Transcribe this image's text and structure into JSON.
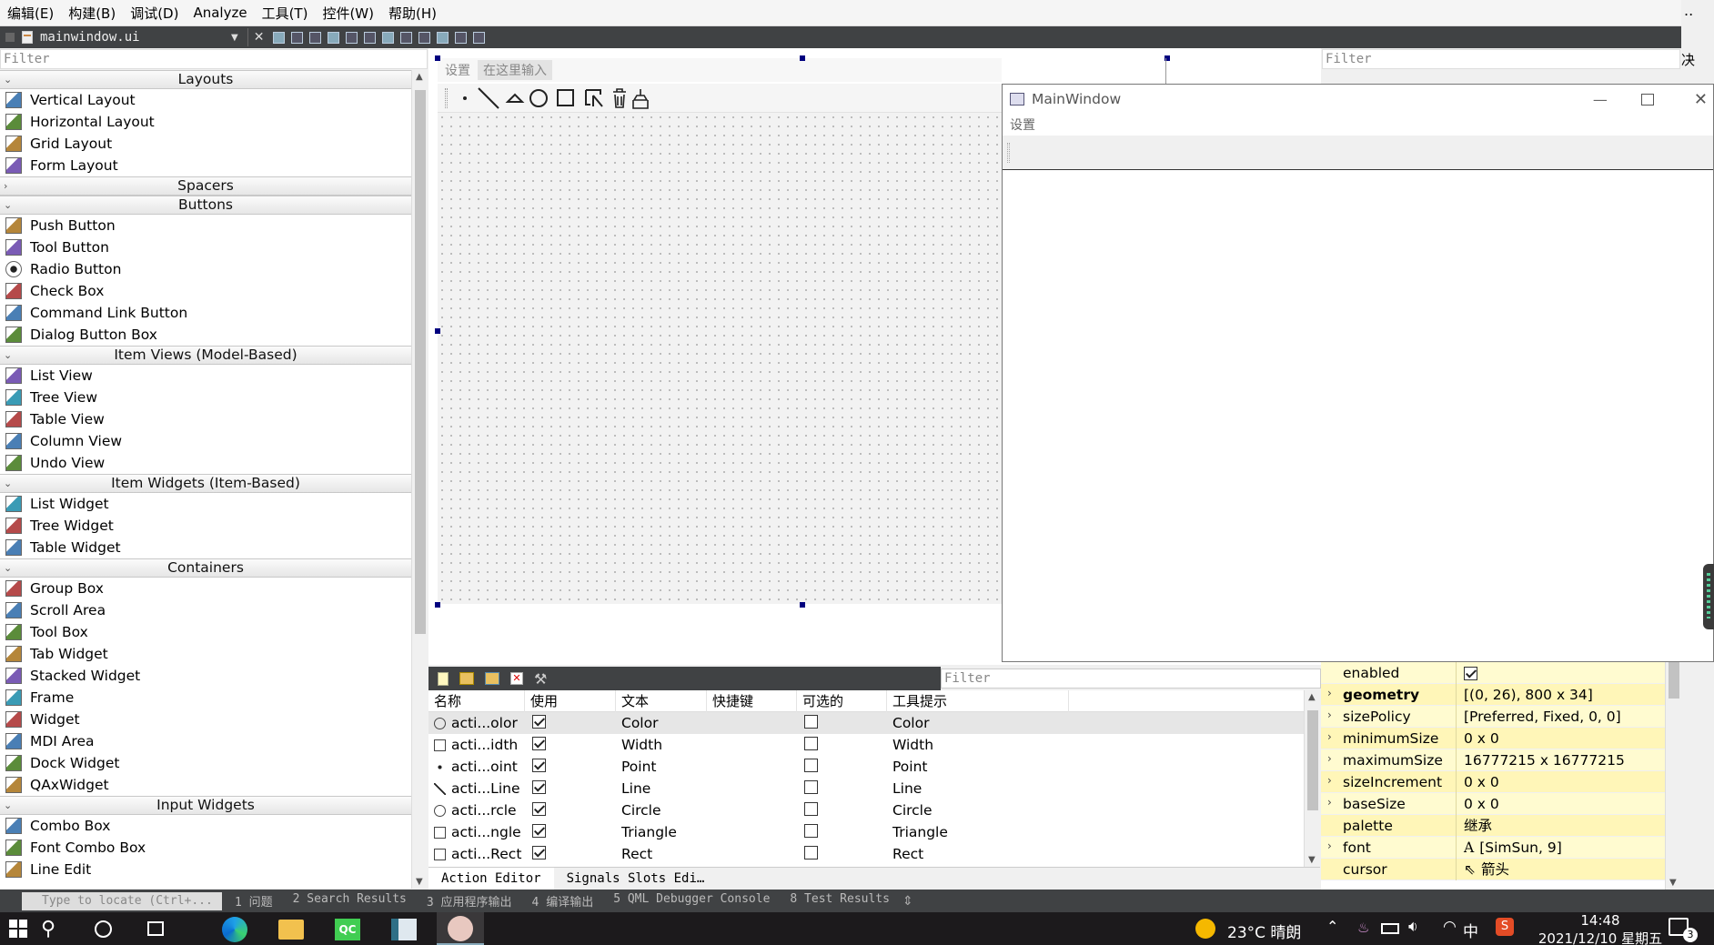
{
  "menu": [
    "编辑(E)",
    "构建(B)",
    "调试(D)",
    "Analyze",
    "工具(T)",
    "控件(W)",
    "帮助(H)"
  ],
  "editor_tab": {
    "file": "mainwindow.ui"
  },
  "widget_filter": "Filter",
  "right_filter": "Filter",
  "right_edge_text": "决",
  "top_right_text": "..",
  "widget_box": [
    {
      "category": "Layouts",
      "collapsed": false,
      "items": [
        "Vertical Layout",
        "Horizontal Layout",
        "Grid Layout",
        "Form Layout"
      ]
    },
    {
      "category": "Spacers",
      "collapsed": true,
      "items": []
    },
    {
      "category": "Buttons",
      "collapsed": false,
      "items": [
        "Push Button",
        "Tool Button",
        "Radio Button",
        "Check Box",
        "Command Link Button",
        "Dialog Button Box"
      ]
    },
    {
      "category": "Item Views (Model-Based)",
      "collapsed": false,
      "items": [
        "List View",
        "Tree View",
        "Table View",
        "Column View",
        "Undo View"
      ]
    },
    {
      "category": "Item Widgets (Item-Based)",
      "collapsed": false,
      "items": [
        "List Widget",
        "Tree Widget",
        "Table Widget"
      ]
    },
    {
      "category": "Containers",
      "collapsed": false,
      "items": [
        "Group Box",
        "Scroll Area",
        "Tool Box",
        "Tab Widget",
        "Stacked Widget",
        "Frame",
        "Widget",
        "MDI Area",
        "Dock Widget",
        "QAxWidget"
      ]
    },
    {
      "category": "Input Widgets",
      "collapsed": false,
      "items": [
        "Combo Box",
        "Font Combo Box",
        "Line Edit"
      ]
    }
  ],
  "form_menu": {
    "item": "设置",
    "placeholder": "在这里输入"
  },
  "main_window": {
    "title": "MainWindow",
    "menu_item": "设置"
  },
  "action_filter": "Filter",
  "action_editor": {
    "columns": [
      "名称",
      "使用",
      "文本",
      "快捷键",
      "可选的",
      "工具提示"
    ],
    "rows": [
      {
        "name": "acti...olor",
        "used": true,
        "text": "Color",
        "shortcut": "",
        "checkable": false,
        "tooltip": "Color",
        "icon": "palette-icon"
      },
      {
        "name": "acti...idth",
        "used": true,
        "text": "Width",
        "shortcut": "",
        "checkable": false,
        "tooltip": "Width",
        "icon": "width-icon"
      },
      {
        "name": "acti...oint",
        "used": true,
        "text": "Point",
        "shortcut": "",
        "checkable": false,
        "tooltip": "Point",
        "icon": "point-icon"
      },
      {
        "name": "acti...Line",
        "used": true,
        "text": "Line",
        "shortcut": "",
        "checkable": false,
        "tooltip": "Line",
        "icon": "line-icon"
      },
      {
        "name": "acti...rcle",
        "used": true,
        "text": "Circle",
        "shortcut": "",
        "checkable": false,
        "tooltip": "Circle",
        "icon": "circle-icon"
      },
      {
        "name": "acti...ngle",
        "used": true,
        "text": "Triangle",
        "shortcut": "",
        "checkable": false,
        "tooltip": "Triangle",
        "icon": "triangle-icon"
      },
      {
        "name": "acti...Rect",
        "used": true,
        "text": "Rect",
        "shortcut": "",
        "checkable": false,
        "tooltip": "Rect",
        "icon": "rect-icon"
      }
    ],
    "tabs": [
      "Action Editor",
      "Signals  Slots Edi…"
    ]
  },
  "properties": [
    {
      "name": "enabled",
      "value": "",
      "bold": false,
      "expandable": false,
      "checkbox": true
    },
    {
      "name": "geometry",
      "value": "[(0, 26), 800 x 34]",
      "bold": true,
      "expandable": true
    },
    {
      "name": "sizePolicy",
      "value": "[Preferred, Fixed, 0, 0]",
      "bold": false,
      "expandable": true
    },
    {
      "name": "minimumSize",
      "value": "0 x 0",
      "bold": false,
      "expandable": true
    },
    {
      "name": "maximumSize",
      "value": "16777215 x 16777215",
      "bold": false,
      "expandable": true
    },
    {
      "name": "sizeIncrement",
      "value": "0 x 0",
      "bold": false,
      "expandable": true
    },
    {
      "name": "baseSize",
      "value": "0 x 0",
      "bold": false,
      "expandable": true
    },
    {
      "name": "palette",
      "value": "继承",
      "bold": false,
      "expandable": false
    },
    {
      "name": "font",
      "value": "[SimSun, 9]",
      "bold": false,
      "expandable": true,
      "prefix": "A"
    },
    {
      "name": "cursor",
      "value": "箭头",
      "bold": false,
      "expandable": false
    }
  ],
  "status_bar": {
    "search_placeholder": "Type to locate (Ctrl+...",
    "items": [
      "1 问题",
      "2 Search Results",
      "3 应用程序输出",
      "4 编译输出",
      "5 QML Debugger Console",
      "8 Test Results"
    ]
  },
  "taskbar": {
    "weather": "23°C 晴朗",
    "ime": "中",
    "time": "14:48",
    "date": "2021/12/10 星期五",
    "notifications": "3"
  }
}
